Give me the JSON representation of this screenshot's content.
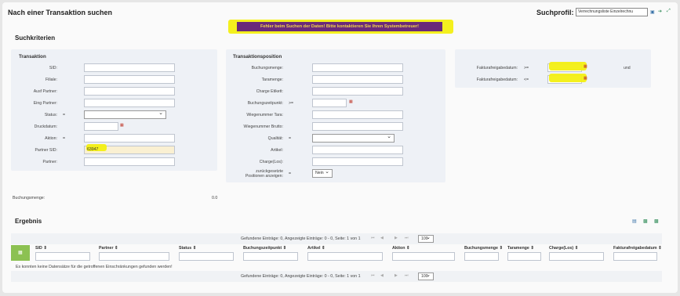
{
  "header": {
    "title": "Nach einer Transaktion suchen",
    "profile_label": "Suchprofil:",
    "profile_value": "Verrechnungsliste Einzelrechnu"
  },
  "error": "Fehler beim Suchen der Daten! Bitte kontaktieren Sie Ihren Systembetreuer!",
  "search": {
    "heading": "Suchkriterien",
    "transaktion": {
      "heading": "Transaktion",
      "sid": "SID:",
      "filiale": "Filiale:",
      "ausf_partner": "Ausf Partner:",
      "eing_partner": "Eing Partner:",
      "status": "Status:",
      "status_op": "=",
      "druckdatum": "Druckdatum:",
      "aktion": "Aktion:",
      "aktion_op": "=",
      "partner_sid": "Partner SID:",
      "partner_sid_value": "63947",
      "partner": "Partner:"
    },
    "position": {
      "heading": "Transaktionsposition",
      "buchungsmenge": "Buchungsmenge:",
      "taramenge": "Taramenge:",
      "charge_etikett": "Charge Etikett:",
      "buchungszeitpunkt": "Buchungszeitpunkt:",
      "buchungszeitpunkt_op": ">=",
      "wiegenummer_tara": "Wiegenummer Tara:",
      "wiegenummer_brutto": "Wiegenummer Brutto:",
      "qualitaet": "Qualität:",
      "qualitaet_op": "=",
      "artikel": "Artikel:",
      "charge_los": "Charge(Los):",
      "zurueck_1": "zurückgesetzte",
      "zurueck_2": "Positionen anzeigen:",
      "zurueck_op": "=",
      "zurueck_value": "Nein"
    },
    "faktura": {
      "label1": "Fakturafreigabedatum:",
      "op1": ">=",
      "label2": "Fakturafreigabedatum:",
      "op2": "<=",
      "und": "und"
    },
    "buchungsmenge_label": "Buchungsmenge:",
    "buchungsmenge_value": "0.0"
  },
  "results": {
    "heading": "Ergebnis",
    "pager_text": "Gefundene Einträge: 0, Angezeigte Einträge: 0 - 0, Seite: 1 von 1",
    "page_size": "100",
    "columns": [
      "SID",
      "Partner",
      "Status",
      "Buchungszeitpunkt",
      "Artikel",
      "Aktion",
      "Buchungsmenge",
      "Taramenge",
      "Charge(Los)",
      "Fakturafreigabedatum"
    ],
    "sort_icon": "⇕",
    "empty_message": "Es konnten keine Datensätze für die getroffenen Einschränkungen gefunden werden!"
  },
  "colors": {
    "banner_bg": "#6a2a7a",
    "banner_text": "#f5d44b",
    "highlight": "#f3ef12"
  }
}
